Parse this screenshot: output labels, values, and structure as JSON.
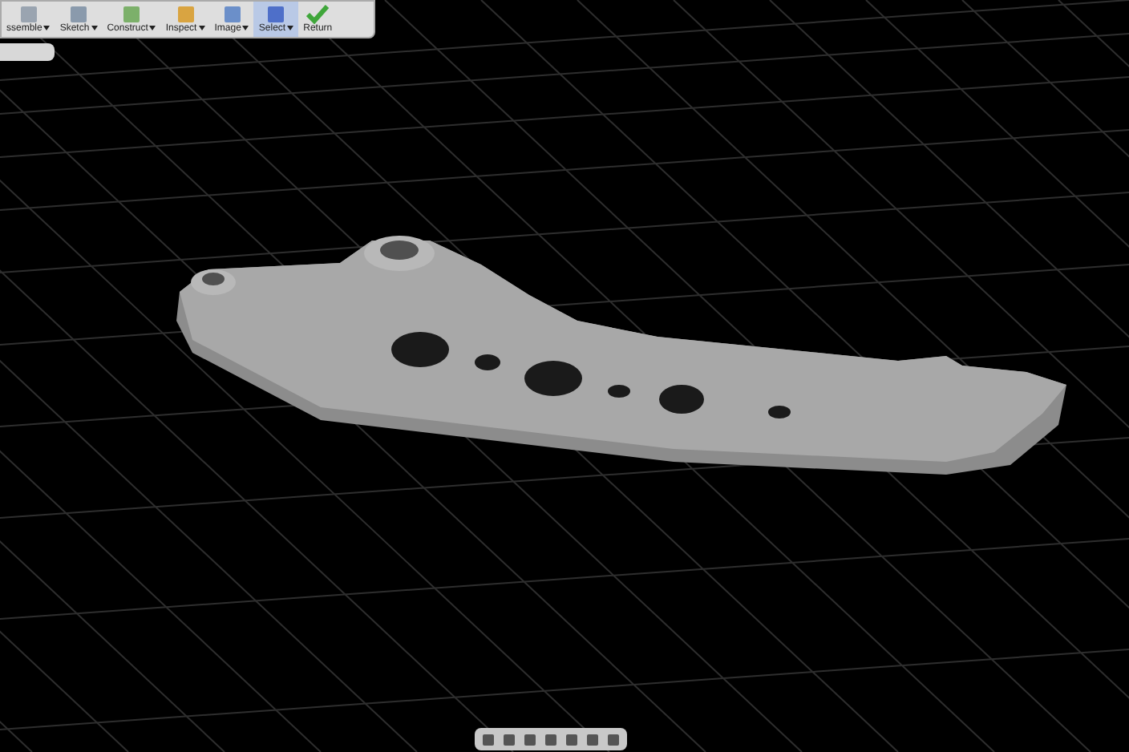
{
  "toolbar": {
    "items": [
      {
        "label": "ssemble",
        "kind": "dropdown",
        "selected": false
      },
      {
        "label": "Sketch",
        "kind": "dropdown",
        "selected": false
      },
      {
        "label": "Construct",
        "kind": "dropdown",
        "selected": false
      },
      {
        "label": "Inspect",
        "kind": "dropdown",
        "selected": false
      },
      {
        "label": "Image",
        "kind": "dropdown",
        "selected": false
      },
      {
        "label": "Select",
        "kind": "dropdown",
        "selected": true
      },
      {
        "label": "Return",
        "kind": "button",
        "selected": false
      }
    ]
  }
}
